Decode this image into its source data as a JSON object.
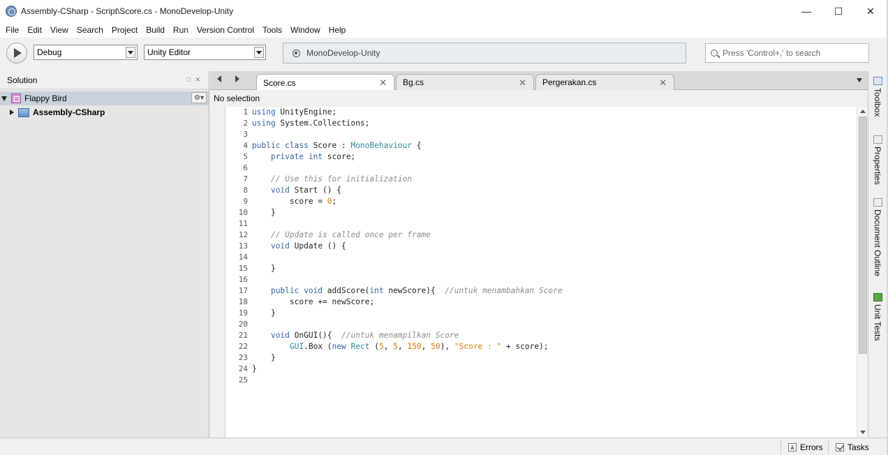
{
  "window": {
    "title": "Assembly-CSharp - Script\\Score.cs - MonoDevelop-Unity",
    "minimize": "—",
    "maximize": "☐",
    "close": "✕"
  },
  "menu": [
    "File",
    "Edit",
    "View",
    "Search",
    "Project",
    "Build",
    "Run",
    "Version Control",
    "Tools",
    "Window",
    "Help"
  ],
  "toolbar": {
    "config": "Debug",
    "target": "Unity Editor",
    "status": "MonoDevelop-Unity",
    "search_placeholder": "Press 'Control+,' to search"
  },
  "solution": {
    "title": "Solution",
    "pad_controls": "□ ✕",
    "gear": "⚙▾",
    "root": "Flappy Bird",
    "project": "Assembly-CSharp"
  },
  "editor": {
    "tabs": [
      {
        "label": "Score.cs",
        "close": "✕"
      },
      {
        "label": "Bg.cs",
        "close": "✕"
      },
      {
        "label": "Pergerakan.cs",
        "close": "✕"
      }
    ],
    "breadcrumb": "No selection",
    "line_numbers": [
      "1",
      "2",
      "3",
      "4",
      "5",
      "6",
      "7",
      "8",
      "9",
      "10",
      "11",
      "12",
      "13",
      "14",
      "15",
      "16",
      "17",
      "18",
      "19",
      "20",
      "21",
      "22",
      "23",
      "24",
      "25"
    ]
  },
  "side_pads": [
    "Toolbox",
    "Properties",
    "Document Outline",
    "Unit Tests"
  ],
  "status_bar": {
    "errors": "Errors",
    "tasks": "Tasks"
  }
}
